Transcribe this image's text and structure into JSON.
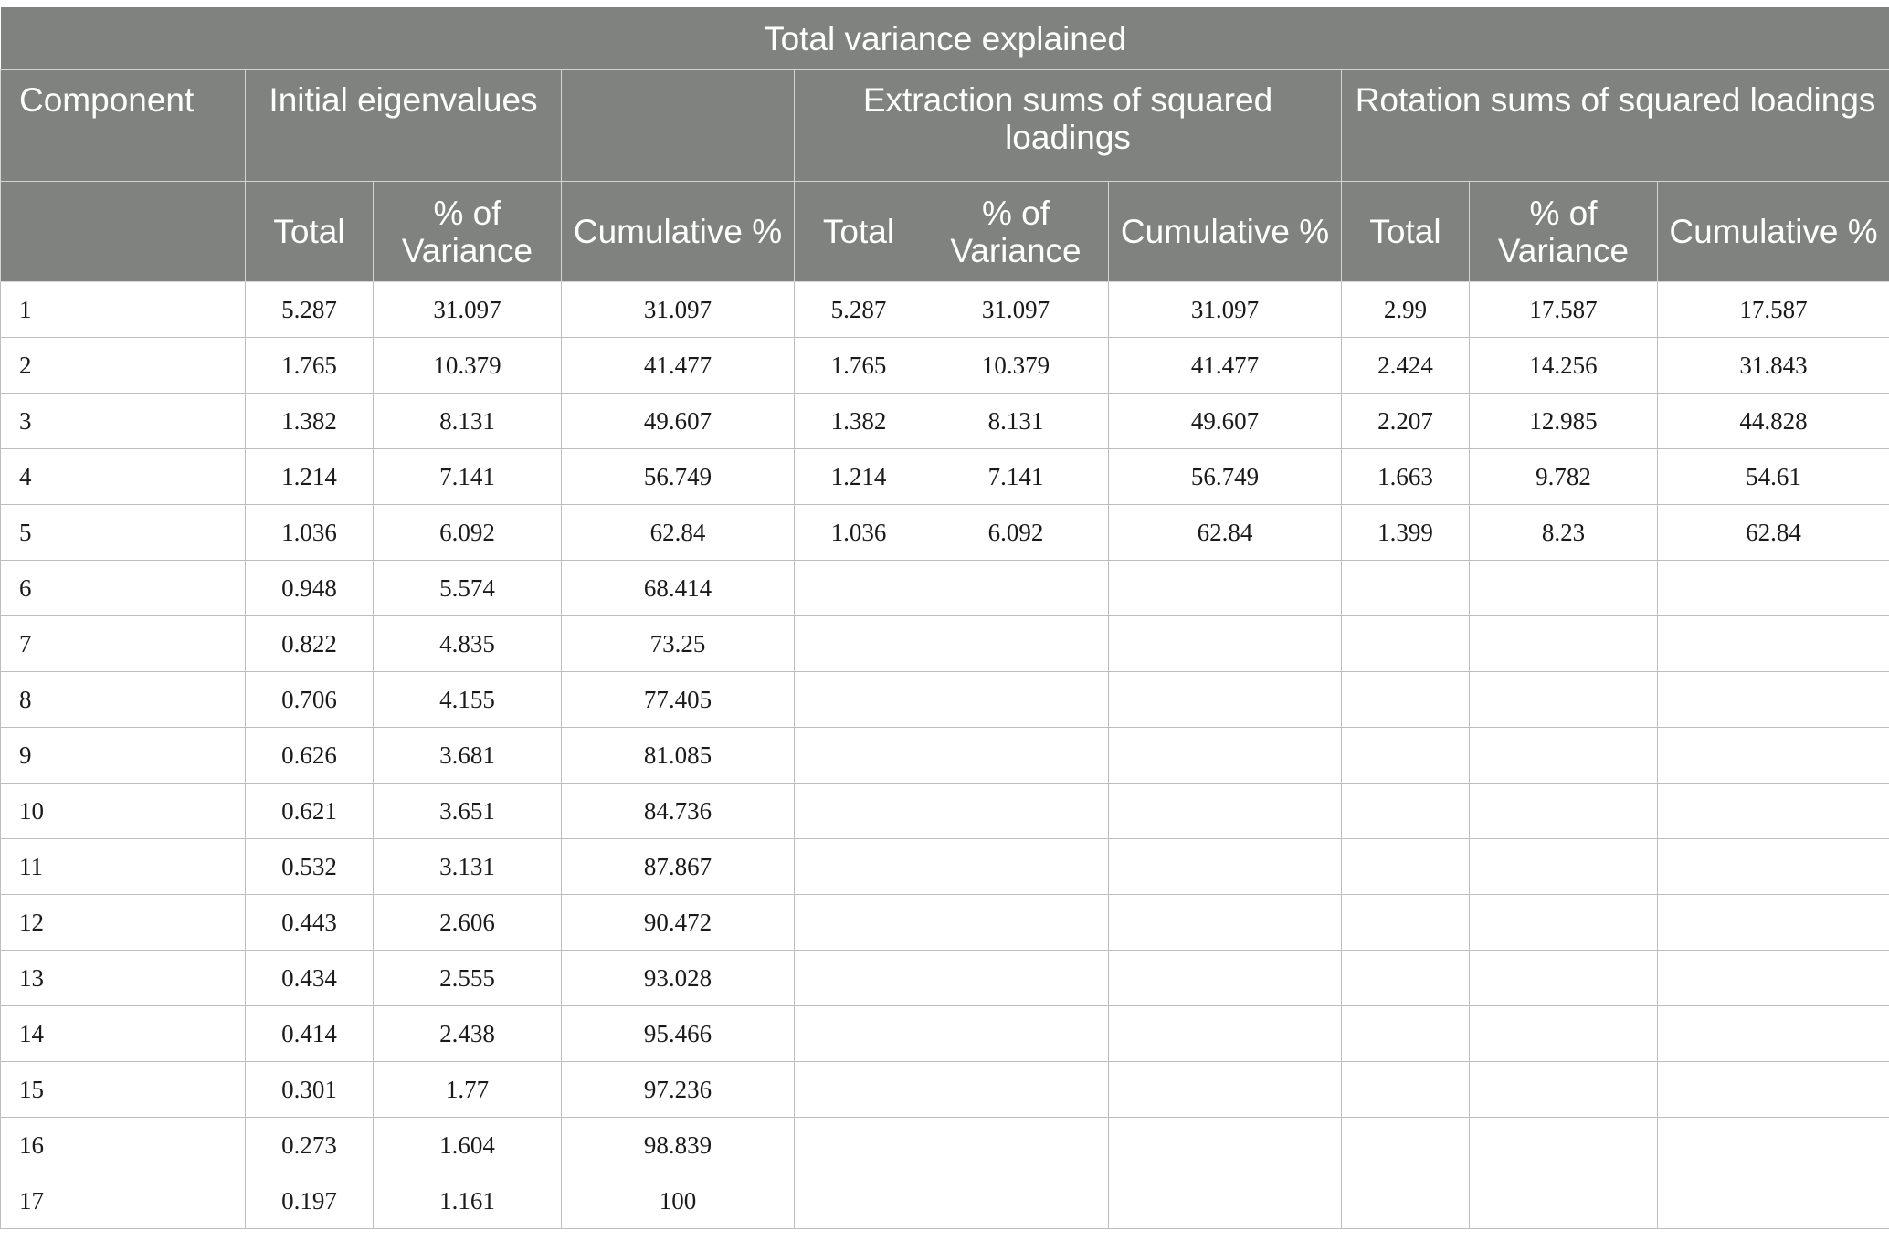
{
  "table": {
    "title": "Total variance explained",
    "group_headers": {
      "component": "Component",
      "initial": "Initial eigenvalues",
      "extraction": "Extraction sums of squared loadings",
      "rotation": "Rotation sums of squared loadings"
    },
    "sub_headers": {
      "total": "Total",
      "pct_variance": "% of Variance",
      "cumulative": "Cumulative %"
    },
    "rows": [
      {
        "component": "1",
        "values": [
          "5.287",
          "31.097",
          "31.097",
          "5.287",
          "31.097",
          "31.097",
          "2.99",
          "17.587",
          "17.587"
        ]
      },
      {
        "component": "2",
        "values": [
          "1.765",
          "10.379",
          "41.477",
          "1.765",
          "10.379",
          "41.477",
          "2.424",
          "14.256",
          "31.843"
        ]
      },
      {
        "component": "3",
        "values": [
          "1.382",
          "8.131",
          "49.607",
          "1.382",
          "8.131",
          "49.607",
          "2.207",
          "12.985",
          "44.828"
        ]
      },
      {
        "component": "4",
        "values": [
          "1.214",
          "7.141",
          "56.749",
          "1.214",
          "7.141",
          "56.749",
          "1.663",
          "9.782",
          "54.61"
        ]
      },
      {
        "component": "5",
        "values": [
          "1.036",
          "6.092",
          "62.84",
          "1.036",
          "6.092",
          "62.84",
          "1.399",
          "8.23",
          "62.84"
        ]
      },
      {
        "component": "6",
        "values": [
          "0.948",
          "5.574",
          "68.414",
          "",
          "",
          "",
          "",
          "",
          ""
        ]
      },
      {
        "component": "7",
        "values": [
          "0.822",
          "4.835",
          "73.25",
          "",
          "",
          "",
          "",
          "",
          ""
        ]
      },
      {
        "component": "8",
        "values": [
          "0.706",
          "4.155",
          "77.405",
          "",
          "",
          "",
          "",
          "",
          ""
        ]
      },
      {
        "component": "9",
        "values": [
          "0.626",
          "3.681",
          "81.085",
          "",
          "",
          "",
          "",
          "",
          ""
        ]
      },
      {
        "component": "10",
        "values": [
          "0.621",
          "3.651",
          "84.736",
          "",
          "",
          "",
          "",
          "",
          ""
        ]
      },
      {
        "component": "11",
        "values": [
          "0.532",
          "3.131",
          "87.867",
          "",
          "",
          "",
          "",
          "",
          ""
        ]
      },
      {
        "component": "12",
        "values": [
          "0.443",
          "2.606",
          "90.472",
          "",
          "",
          "",
          "",
          "",
          ""
        ]
      },
      {
        "component": "13",
        "values": [
          "0.434",
          "2.555",
          "93.028",
          "",
          "",
          "",
          "",
          "",
          ""
        ]
      },
      {
        "component": "14",
        "values": [
          "0.414",
          "2.438",
          "95.466",
          "",
          "",
          "",
          "",
          "",
          ""
        ]
      },
      {
        "component": "15",
        "values": [
          "0.301",
          "1.77",
          "97.236",
          "",
          "",
          "",
          "",
          "",
          ""
        ]
      },
      {
        "component": "16",
        "values": [
          "0.273",
          "1.604",
          "98.839",
          "",
          "",
          "",
          "",
          "",
          ""
        ]
      },
      {
        "component": "17",
        "values": [
          "0.197",
          "1.161",
          "100",
          "",
          "",
          "",
          "",
          "",
          ""
        ]
      }
    ]
  }
}
